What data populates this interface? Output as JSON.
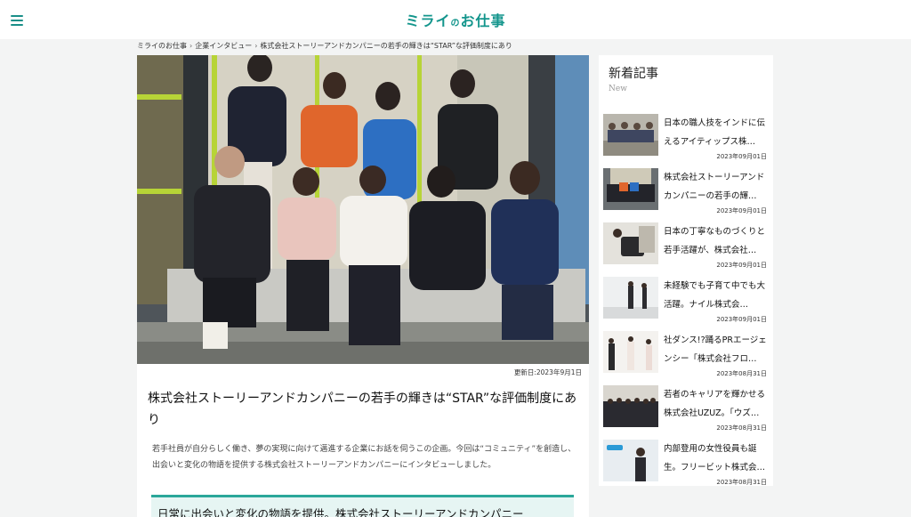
{
  "header": {
    "logo_text": "ミライ",
    "logo_small": "の",
    "logo_rest": "お仕事"
  },
  "breadcrumb": [
    "ミライのお仕事",
    "企業インタビュー",
    "株式会社ストーリーアンドカンパニーの若手の輝きは“STAR”な評価制度にあり"
  ],
  "article": {
    "updated": "更新日:2023年9月1日",
    "title": "株式会社ストーリーアンドカンパニーの若手の輝きは“STAR”な評価制度にあり",
    "lead": "若手社員が自分らしく働き、夢の実現に向けて邁進する企業にお話を伺うこの企画。今回は“コミュニティ”を創造し、出会いと変化の物語を提供する株式会社ストーリーアンドカンパニーにインタビューしました。",
    "section_heading": "日常に出会いと変化の物語を提供。株式会社ストーリーアンドカンパニー"
  },
  "sidebar": {
    "heading": "新着記事",
    "sub": "New",
    "items": [
      {
        "title": "日本の職人技をインドに伝えるアイティップス株…",
        "date": "2023年09月01日"
      },
      {
        "title": "株式会社ストーリーアンドカンパニーの若手の輝…",
        "date": "2023年09月01日"
      },
      {
        "title": "日本の丁寧なものづくりと若手活躍が、株式会社…",
        "date": "2023年09月01日"
      },
      {
        "title": "未経験でも子育て中でも大活躍。ナイル株式会…",
        "date": "2023年09月01日"
      },
      {
        "title": "社ダンス!?踊るPRエージェンシー「株式会社フロ…",
        "date": "2023年08月31日"
      },
      {
        "title": "若者のキャリアを輝かせる株式会社UZUZ。「ウズ…",
        "date": "2023年08月31日"
      },
      {
        "title": "内部登用の女性役員も誕生。フリービット株式会…",
        "date": "2023年08月31日"
      }
    ]
  },
  "colors": {
    "brand": "#13958c",
    "accent": "#2aa79a",
    "callout_bg": "#e6f5f3"
  }
}
